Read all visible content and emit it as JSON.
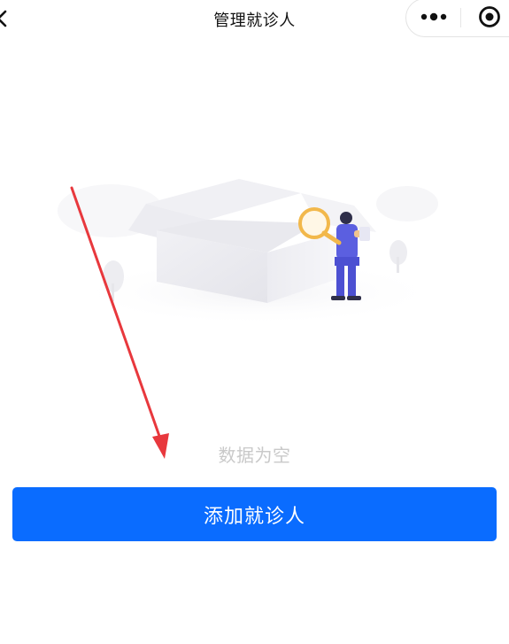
{
  "header": {
    "title": "管理就诊人",
    "back_icon": "chevron-left-icon",
    "more_icon": "more-dots-icon",
    "target_icon": "target-circle-icon"
  },
  "empty_state": {
    "illustration": "empty-box-with-person-magnifier",
    "text": "数据为空"
  },
  "actions": {
    "add_label": "添加就诊人"
  },
  "colors": {
    "primary": "#0a6cff",
    "empty_text": "#c9c9c9",
    "annotation_arrow": "#e8383d"
  }
}
